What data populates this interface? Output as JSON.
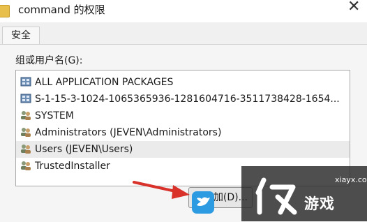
{
  "window": {
    "title": "command 的权限",
    "close_glyph": "✕"
  },
  "tabs": [
    {
      "label": "安全"
    }
  ],
  "permissions": {
    "group_label": "组或用户名(G):",
    "principals": [
      {
        "name": "ALL APPLICATION PACKAGES",
        "icon": "app-packages-icon",
        "selected": false
      },
      {
        "name": "S-1-15-3-1024-1065365936-1281604716-3511738428-1654...",
        "icon": "app-packages-icon",
        "selected": false
      },
      {
        "name": "SYSTEM",
        "icon": "users-group-icon",
        "selected": false
      },
      {
        "name": "Administrators (JEVEN\\Administrators)",
        "icon": "users-group-icon",
        "selected": false
      },
      {
        "name": "Users (JEVEN\\Users)",
        "icon": "users-group-icon",
        "selected": true
      },
      {
        "name": "TrustedInstaller",
        "icon": "users-group-icon",
        "selected": false
      }
    ],
    "add_button_label": "加(D)..."
  },
  "watermark": {
    "url": "xiayx.com",
    "brand": "游戏"
  },
  "colors": {
    "arrow": "#d9322b",
    "badge": "#2d9be2"
  }
}
